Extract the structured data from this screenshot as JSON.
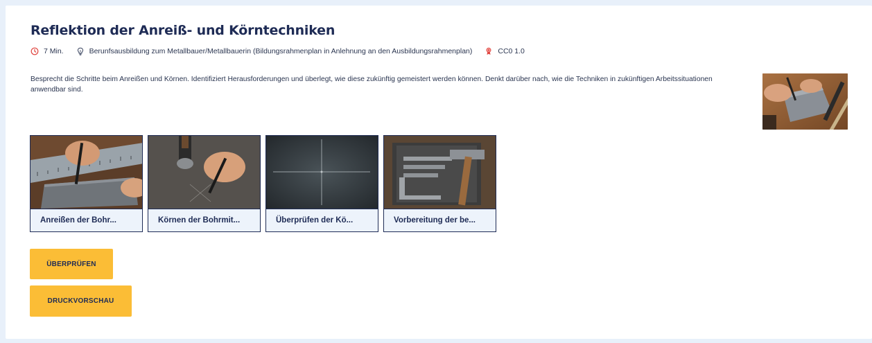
{
  "activity": {
    "title": "Reflektion der Anreiß- und Körntechniken",
    "duration": "7 Min.",
    "context": "Berunfsausbildung zum Metallbauer/Metallbauerin (Bildungsrahmenplan in Anlehnung an den Ausbildungsrahmenplan)",
    "license": "CC0 1.0",
    "description": "Besprecht die Schritte beim Anreißen und Körnen. Identifiziert Herausforderungen und überlegt, wie diese zukünftig gemeistert werden können. Denkt darüber nach, wie die Techniken in zukünftigen Arbeitssituationen anwendbar sind."
  },
  "icons": {
    "duration": "clock-icon",
    "context": "lightbulb-icon",
    "license": "license-icon",
    "accent": "#e0453f"
  },
  "tiles": [
    {
      "label": "Anreißen der Bohr..."
    },
    {
      "label": "Körnen der Bohrmit..."
    },
    {
      "label": "Überprüfen der Kö..."
    },
    {
      "label": "Vorbereitung der be..."
    }
  ],
  "buttons": {
    "check": "ÜBERPRÜFEN",
    "print": "DRUCKVORSCHAU"
  },
  "colors": {
    "accent": "#fbbd36",
    "title": "#1e2b55",
    "background": "#e8f0fa"
  }
}
